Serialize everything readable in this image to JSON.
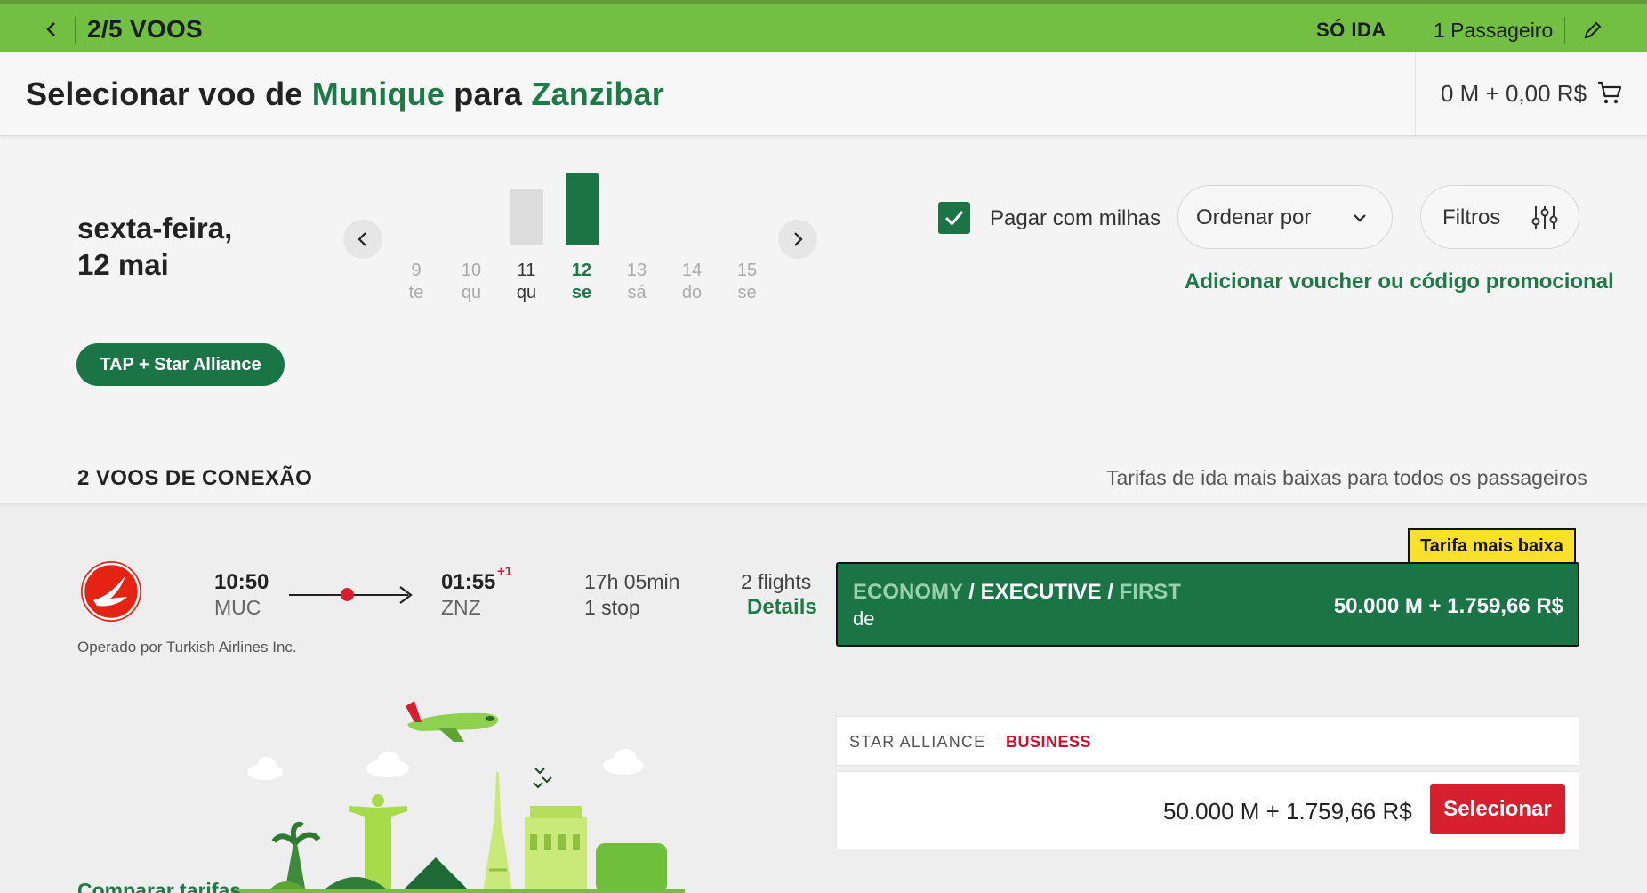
{
  "topbar": {
    "step": "2/5 VOOS",
    "trip_type": "SÓ IDA",
    "passengers": "1 Passageiro"
  },
  "header": {
    "title_prefix": "Selecionar voo de ",
    "origin": "Munique",
    "title_mid": " para ",
    "destination": "Zanzibar",
    "cart_total": "0 M + 0,00 R$"
  },
  "date": {
    "line1": "sexta-feira,",
    "line2": "12 mai"
  },
  "calendar": {
    "days": [
      {
        "num": "9",
        "dow": "te",
        "state": "unavailable"
      },
      {
        "num": "10",
        "dow": "qu",
        "state": "unavailable"
      },
      {
        "num": "11",
        "dow": "qu",
        "state": "available",
        "fare_level": 0.62
      },
      {
        "num": "12",
        "dow": "se",
        "state": "selected",
        "fare_level": 0.78
      },
      {
        "num": "13",
        "dow": "sá",
        "state": "unavailable"
      },
      {
        "num": "14",
        "dow": "do",
        "state": "unavailable"
      },
      {
        "num": "15",
        "dow": "se",
        "state": "unavailable"
      }
    ]
  },
  "controls": {
    "pay_with_miles_label": "Pagar com milhas",
    "pay_with_miles_checked": true,
    "sort_label": "Ordenar por",
    "filters_label": "Filtros",
    "voucher_link": "Adicionar voucher ou código promocional"
  },
  "alliance_chip": "TAP + Star Alliance",
  "section": {
    "heading": "2 VOOS DE CONEXÃO",
    "note": "Tarifas de ida mais baixas para todos os passageiros"
  },
  "flight": {
    "depart_time": "10:50",
    "depart_code": "MUC",
    "arrive_time": "01:55",
    "day_offset": "+1",
    "arrive_code": "ZNZ",
    "duration": "17h 05min",
    "stops": "1 stop",
    "flights_count": "2 flights",
    "details_link": "Details",
    "operated_by": "Operado por Turkish Airlines Inc.",
    "lowest_badge": "Tarifa mais baixa",
    "fare_class_economy": "ECONOMY",
    "fare_class_executive": "EXECUTIVE",
    "fare_class_first": "FIRST",
    "fare_sep": " / ",
    "fare_from": "de",
    "fare_price": "50.000 M + 1.759,66 R$",
    "star_alliance_label": "STAR ALLIANCE",
    "business_label": "BUSINESS",
    "business_price": "50.000 M + 1.759,66 R$",
    "select_button": "Selecionar",
    "compare_link": "Comparar tarifas"
  },
  "colors": {
    "brand_green": "#72bf44",
    "dark_green": "#1a7446",
    "accent_red": "#d6202f",
    "badge_yellow": "#f9e02a"
  }
}
